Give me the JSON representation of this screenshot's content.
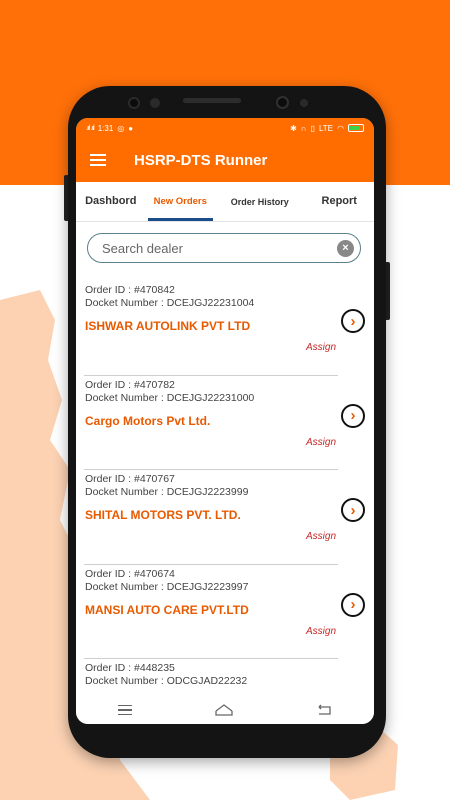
{
  "status_bar": {
    "time": "1:31",
    "signal_left": ".ııl .ııl",
    "icons_right": [
      "bluetooth-icon",
      "headset-icon",
      "vibrate-icon",
      "lte-icon",
      "wifi-icon",
      "battery-icon"
    ],
    "lte_text": "LTE"
  },
  "app": {
    "title": "HSRP-DTS Runner",
    "accent": "#ff6d00",
    "tab_indicator_color": "#1b4d8a"
  },
  "tabs": [
    {
      "label": "Dashbord"
    },
    {
      "label": "New Orders",
      "active": true
    },
    {
      "label": "Order History"
    },
    {
      "label": "Report"
    }
  ],
  "search": {
    "placeholder": "Search dealer",
    "value": ""
  },
  "orders": [
    {
      "order_id": "Order ID : #470842",
      "docket": "Docket Number : DCEJGJ22231004",
      "dealer": "ISHWAR AUTOLINK PVT LTD",
      "action": "Assign"
    },
    {
      "order_id": "Order ID : #470782",
      "docket": "Docket Number : DCEJGJ22231000",
      "dealer": "Cargo Motors Pvt Ltd.",
      "action": "Assign"
    },
    {
      "order_id": "Order ID : #470767",
      "docket": "Docket Number : DCEJGJ2223999",
      "dealer": "SHITAL MOTORS PVT. LTD.",
      "action": "Assign"
    },
    {
      "order_id": "Order ID : #470674",
      "docket": "Docket Number : DCEJGJ2223997",
      "dealer": "MANSI AUTO CARE PVT.LTD",
      "action": "Assign"
    },
    {
      "order_id": "Order ID : #448235",
      "docket": "Docket Number : ODCGJAD22232",
      "dealer": "",
      "action": ""
    }
  ],
  "nav_bar": [
    "recents-icon",
    "home-icon",
    "back-icon"
  ]
}
